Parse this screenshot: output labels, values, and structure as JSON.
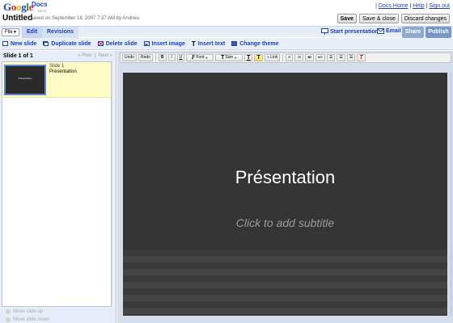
{
  "header": {
    "logo": "Google",
    "logo_docs": "Docs",
    "logo_beta": "BETA",
    "links": [
      "Docs Home",
      "Help",
      "Sign out"
    ],
    "doc_title": "Untitled",
    "saved_text": "saved on September 18, 2007 7:37 AM by Andrieu",
    "buttons": {
      "save": "Save",
      "save_close": "Save & close",
      "discard": "Discard changes"
    }
  },
  "tabbar": {
    "file": "File",
    "tabs": [
      "Edit",
      "Revisions"
    ],
    "start_presentation": "Start presentation",
    "email": "Email",
    "share": "Share",
    "publish": "Publish"
  },
  "actions": {
    "new_slide": "New slide",
    "duplicate_slide": "Duplicate slide",
    "delete_slide": "Delete slide",
    "insert_image": "Insert image",
    "insert_text": "Insert text",
    "change_theme": "Change theme"
  },
  "slides_panel": {
    "count": "Slide 1 of 1",
    "prev": "« Prev",
    "next": "Next »",
    "slides": [
      {
        "num": "Slide 1",
        "name": "Présentation",
        "thumb_text": "Présentation"
      }
    ],
    "move_up": "Move slide up",
    "move_down": "Move slide down"
  },
  "editor_toolbar": {
    "undo": "Undo",
    "redo": "Redo",
    "bold": "B",
    "italic": "I",
    "underline": "U",
    "font": "Font",
    "size": "Size",
    "link": "Link"
  },
  "slide": {
    "title": "Présentation",
    "subtitle": "Click to add subtitle"
  },
  "colors": {
    "link_blue": "#1a3fbf",
    "bar_bg": "#e8eef8",
    "slide_bg": "#353535",
    "share_bg": "#90a9d3",
    "publish_bg": "#7797cb",
    "selected_slide_bg": "#fffbc4"
  }
}
